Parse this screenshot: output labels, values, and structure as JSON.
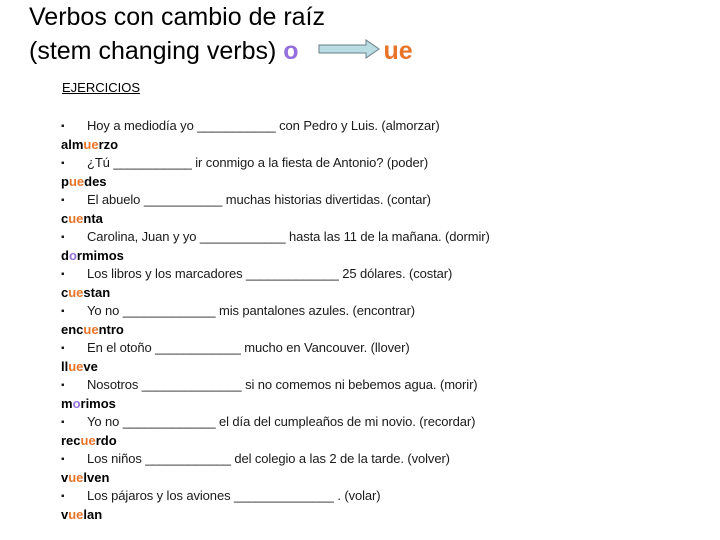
{
  "title": {
    "line1": "Verbos con cambio de raíz",
    "line2_prefix": "(stem changing verbs)",
    "from_vowel": "o",
    "to_vowel": "ue",
    "arrow_icon": "right-arrow-icon"
  },
  "colors": {
    "o_highlight": "#9370db",
    "ue_highlight": "#e8742a",
    "arrow_fill": "#b9dde3"
  },
  "section_heading": "EJERCICIOS",
  "bullet": "▪",
  "exercises": [
    {
      "question": "Hoy a mediodía yo ___________ con Pedro y Luis. (almorzar)",
      "answer_pre": "alm",
      "answer_hl": "ue",
      "answer_post": "rzo",
      "hl_type": "ue"
    },
    {
      "question": "¿Tú ___________ ir conmigo a la fiesta de Antonio? (poder)",
      "answer_pre": "p",
      "answer_hl": "ue",
      "answer_post": "des",
      "hl_type": "ue"
    },
    {
      "question": "El abuelo ___________ muchas historias divertidas. (contar)",
      "answer_pre": "c",
      "answer_hl": "ue",
      "answer_post": "nta",
      "hl_type": "ue"
    },
    {
      "question": "Carolina, Juan y yo ____________ hasta las 11 de la mañana. (dormir)",
      "answer_pre": "d",
      "answer_hl": "o",
      "answer_post": "rmimos",
      "hl_type": "o"
    },
    {
      "question": "Los libros y los marcadores _____________ 25 dólares. (costar)",
      "answer_pre": "c",
      "answer_hl": "ue",
      "answer_post": "stan",
      "hl_type": "ue"
    },
    {
      "question": "Yo no _____________ mis pantalones azules. (encontrar)",
      "answer_pre": "enc",
      "answer_hl": "ue",
      "answer_post": "ntro",
      "hl_type": "ue"
    },
    {
      "question": "En el otoño ____________ mucho en Vancouver. (llover)",
      "answer_pre": "ll",
      "answer_hl": "ue",
      "answer_post": "ve",
      "hl_type": "ue"
    },
    {
      "question": "Nosotros ______________ si no comemos ni bebemos agua. (morir)",
      "answer_pre": "m",
      "answer_hl": "o",
      "answer_post": "rimos",
      "hl_type": "o"
    },
    {
      "question": "Yo no _____________ el día del cumpleaños de mi novio. (recordar)",
      "answer_pre": "rec",
      "answer_hl": "ue",
      "answer_post": "rdo",
      "hl_type": "ue"
    },
    {
      "question": "Los niños ____________ del colegio a las 2 de la tarde. (volver)",
      "answer_pre": "v",
      "answer_hl": "ue",
      "answer_post": "lven",
      "hl_type": "ue"
    },
    {
      "question": "Los pájaros y los aviones ______________ . (volar)",
      "answer_pre": "v",
      "answer_hl": "ue",
      "answer_post": "lan",
      "hl_type": "ue"
    }
  ]
}
